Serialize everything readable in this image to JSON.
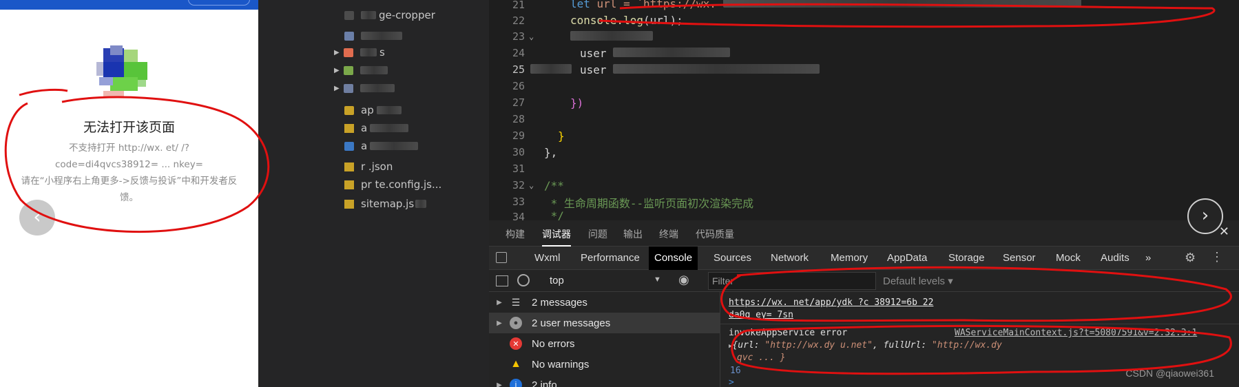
{
  "phone": {
    "error_title": "无法打开该页面",
    "error_line1": "不支持打开 http://wx.          et/          /?",
    "error_line2": "code=di4qvcs38912=          ...          nkey=",
    "error_hint_line1": "请在“小程序右上角更多->反馈与投诉”中和开发者反",
    "error_hint_line2": "馈。",
    "back_glyph": "‹"
  },
  "filetree": {
    "items": [
      {
        "label": "ge-cropper"
      },
      {
        "label": "s"
      },
      {
        "label": ""
      },
      {
        "label": ""
      },
      {
        "label": "ap"
      },
      {
        "label": "a"
      },
      {
        "label": "a"
      },
      {
        "label": "r          .json"
      },
      {
        "label": "pr          te.config.js..."
      },
      {
        "label": "sitemap.js"
      }
    ]
  },
  "editor": {
    "line_numbers": [
      "21",
      "22",
      "23",
      "24",
      "25",
      "26",
      "27",
      "28",
      "29",
      "30",
      "31",
      "32",
      "33",
      "34"
    ],
    "active_line": "25",
    "code": {
      "l21_kw": "let",
      "l21_rest": " url = `https://wx.",
      "l22_fn": "console.log",
      "l22_rest": "(url);",
      "l24_rest": "user",
      "l25_rest": "user",
      "l27_rest": "})",
      "l29_rest": "}",
      "l30_rest": "},",
      "l32_rest": "/**",
      "l33_rest": " * 生命周期函数--监听页面初次渲染完成",
      "l34_rest": " */"
    }
  },
  "devtools": {
    "top_tabs": [
      "构建",
      "调试器",
      "问题",
      "输出",
      "终端",
      "代码质量"
    ],
    "active_top_tab": "调试器",
    "panel_tabs": [
      "Wxml",
      "Performance",
      "Console",
      "Sources",
      "Network",
      "Memory",
      "AppData",
      "Storage",
      "Sensor",
      "Mock",
      "Audits"
    ],
    "active_panel_tab": "Console",
    "more_tabs_glyph": "»",
    "context": "top",
    "filter_placeholder": "Filter",
    "levels": "Default levels ▾",
    "sidebar": [
      {
        "label": "2 messages",
        "icon": "list-icon"
      },
      {
        "label": "2 user messages",
        "icon": "user-icon"
      },
      {
        "label": "No errors",
        "icon": "error-icon"
      },
      {
        "label": "No warnings",
        "icon": "warning-icon"
      },
      {
        "label": "2 info",
        "icon": "info-icon"
      }
    ],
    "log1_line1": "https://wx.          net/app/ydk          ?c          38912=6b          22",
    "log1_line2": "da0q          ey=          7sn",
    "log2_label": "invokeAppService error",
    "log2_source": "WAServiceMainContext.js?t=50807591&v=2.32.3:1",
    "log2_obj_key1": "url:",
    "log2_obj_val1": "\"http://wx.dy    u.net\"",
    "log2_obj_key2": ", fullUrl:",
    "log2_obj_val2": "\"http://wx.dy",
    "log2_line2": "qvc          ...          }",
    "log_number": "16",
    "prompt": ">"
  },
  "watermark": "CSDN @qiaowei361",
  "next_glyph": "›"
}
